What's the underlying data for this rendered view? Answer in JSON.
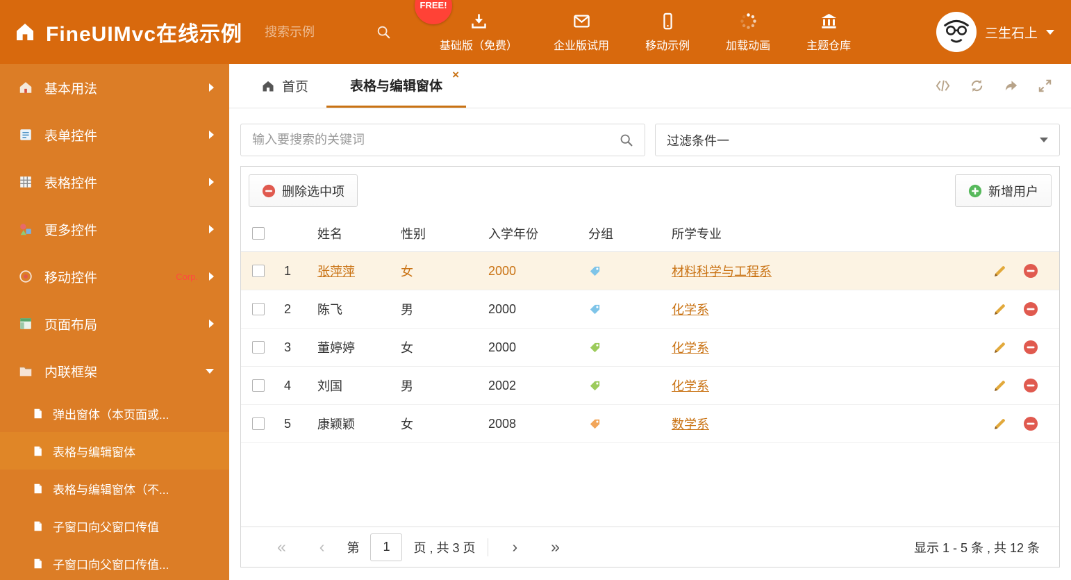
{
  "header": {
    "title": "FineUIMvc在线示例",
    "search_placeholder": "搜索示例",
    "free_badge": "FREE!",
    "nav": [
      {
        "label": "基础版（免费）"
      },
      {
        "label": "企业版试用"
      },
      {
        "label": "移动示例"
      },
      {
        "label": "加载动画"
      },
      {
        "label": "主题仓库"
      }
    ],
    "user_name": "三生石上"
  },
  "sidebar": {
    "items": [
      {
        "label": "基本用法"
      },
      {
        "label": "表单控件"
      },
      {
        "label": "表格控件"
      },
      {
        "label": "更多控件"
      },
      {
        "label": "移动控件",
        "badge": "Corp."
      },
      {
        "label": "页面布局"
      },
      {
        "label": "内联框架"
      }
    ],
    "subitems": [
      {
        "label": "弹出窗体（本页面或..."
      },
      {
        "label": "表格与编辑窗体"
      },
      {
        "label": "表格与编辑窗体（不..."
      },
      {
        "label": "子窗口向父窗口传值"
      },
      {
        "label": "子窗口向父窗口传值..."
      }
    ]
  },
  "tabs": {
    "home": "首页",
    "active": "表格与编辑窗体"
  },
  "filter": {
    "search_placeholder": "输入要搜索的关键词",
    "dropdown_value": "过滤条件一"
  },
  "grid": {
    "delete_button": "删除选中项",
    "add_button": "新增用户",
    "columns": [
      "姓名",
      "性别",
      "入学年份",
      "分组",
      "所学专业"
    ],
    "rows": [
      {
        "index": "1",
        "name": "张萍萍",
        "gender": "女",
        "year": "2000",
        "tag": "blue",
        "major": "材料科学与工程系",
        "selected": true
      },
      {
        "index": "2",
        "name": "陈飞",
        "gender": "男",
        "year": "2000",
        "tag": "blue",
        "major": "化学系",
        "selected": false
      },
      {
        "index": "3",
        "name": "董婷婷",
        "gender": "女",
        "year": "2000",
        "tag": "green",
        "major": "化学系",
        "selected": false
      },
      {
        "index": "4",
        "name": "刘国",
        "gender": "男",
        "year": "2002",
        "tag": "green",
        "major": "化学系",
        "selected": false
      },
      {
        "index": "5",
        "name": "康颖颖",
        "gender": "女",
        "year": "2008",
        "tag": "orange",
        "major": "数学系",
        "selected": false
      }
    ]
  },
  "pagination": {
    "first": "«",
    "prev": "‹",
    "next": "›",
    "last": "»",
    "page_prefix": "第",
    "current_page": "1",
    "page_suffix": "页 , 共 3 页",
    "summary": "显示 1 - 5 条 , 共 12 条"
  },
  "colors": {
    "header_bg": "#D8690D",
    "sidebar_bg": "#DC7D26",
    "sidebar_active": "#E08627",
    "accent": "#C97213",
    "link": "#C97213",
    "row_selected_bg": "#FCF3E3",
    "tag_blue": "#7EC4E8",
    "tag_green": "#9CCB5B",
    "tag_orange": "#F2A65A",
    "delete_red": "#E05A4F",
    "add_green": "#57B95C",
    "pencil": "#E2A93B",
    "free_badge_bg": "#FF4236"
  }
}
